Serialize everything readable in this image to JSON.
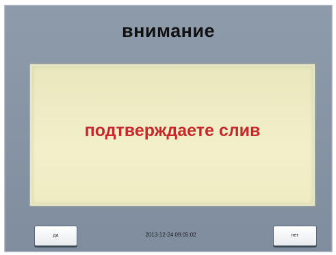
{
  "dialog": {
    "title": "внимание",
    "message": "подтверждаете слив",
    "yes_label": "да",
    "no_label": "нет",
    "datetime": "2013-12-24 09:05:02"
  },
  "colors": {
    "panel": "#8a97a8",
    "message_background": "#f0efc7",
    "message_text": "#c8282b"
  }
}
